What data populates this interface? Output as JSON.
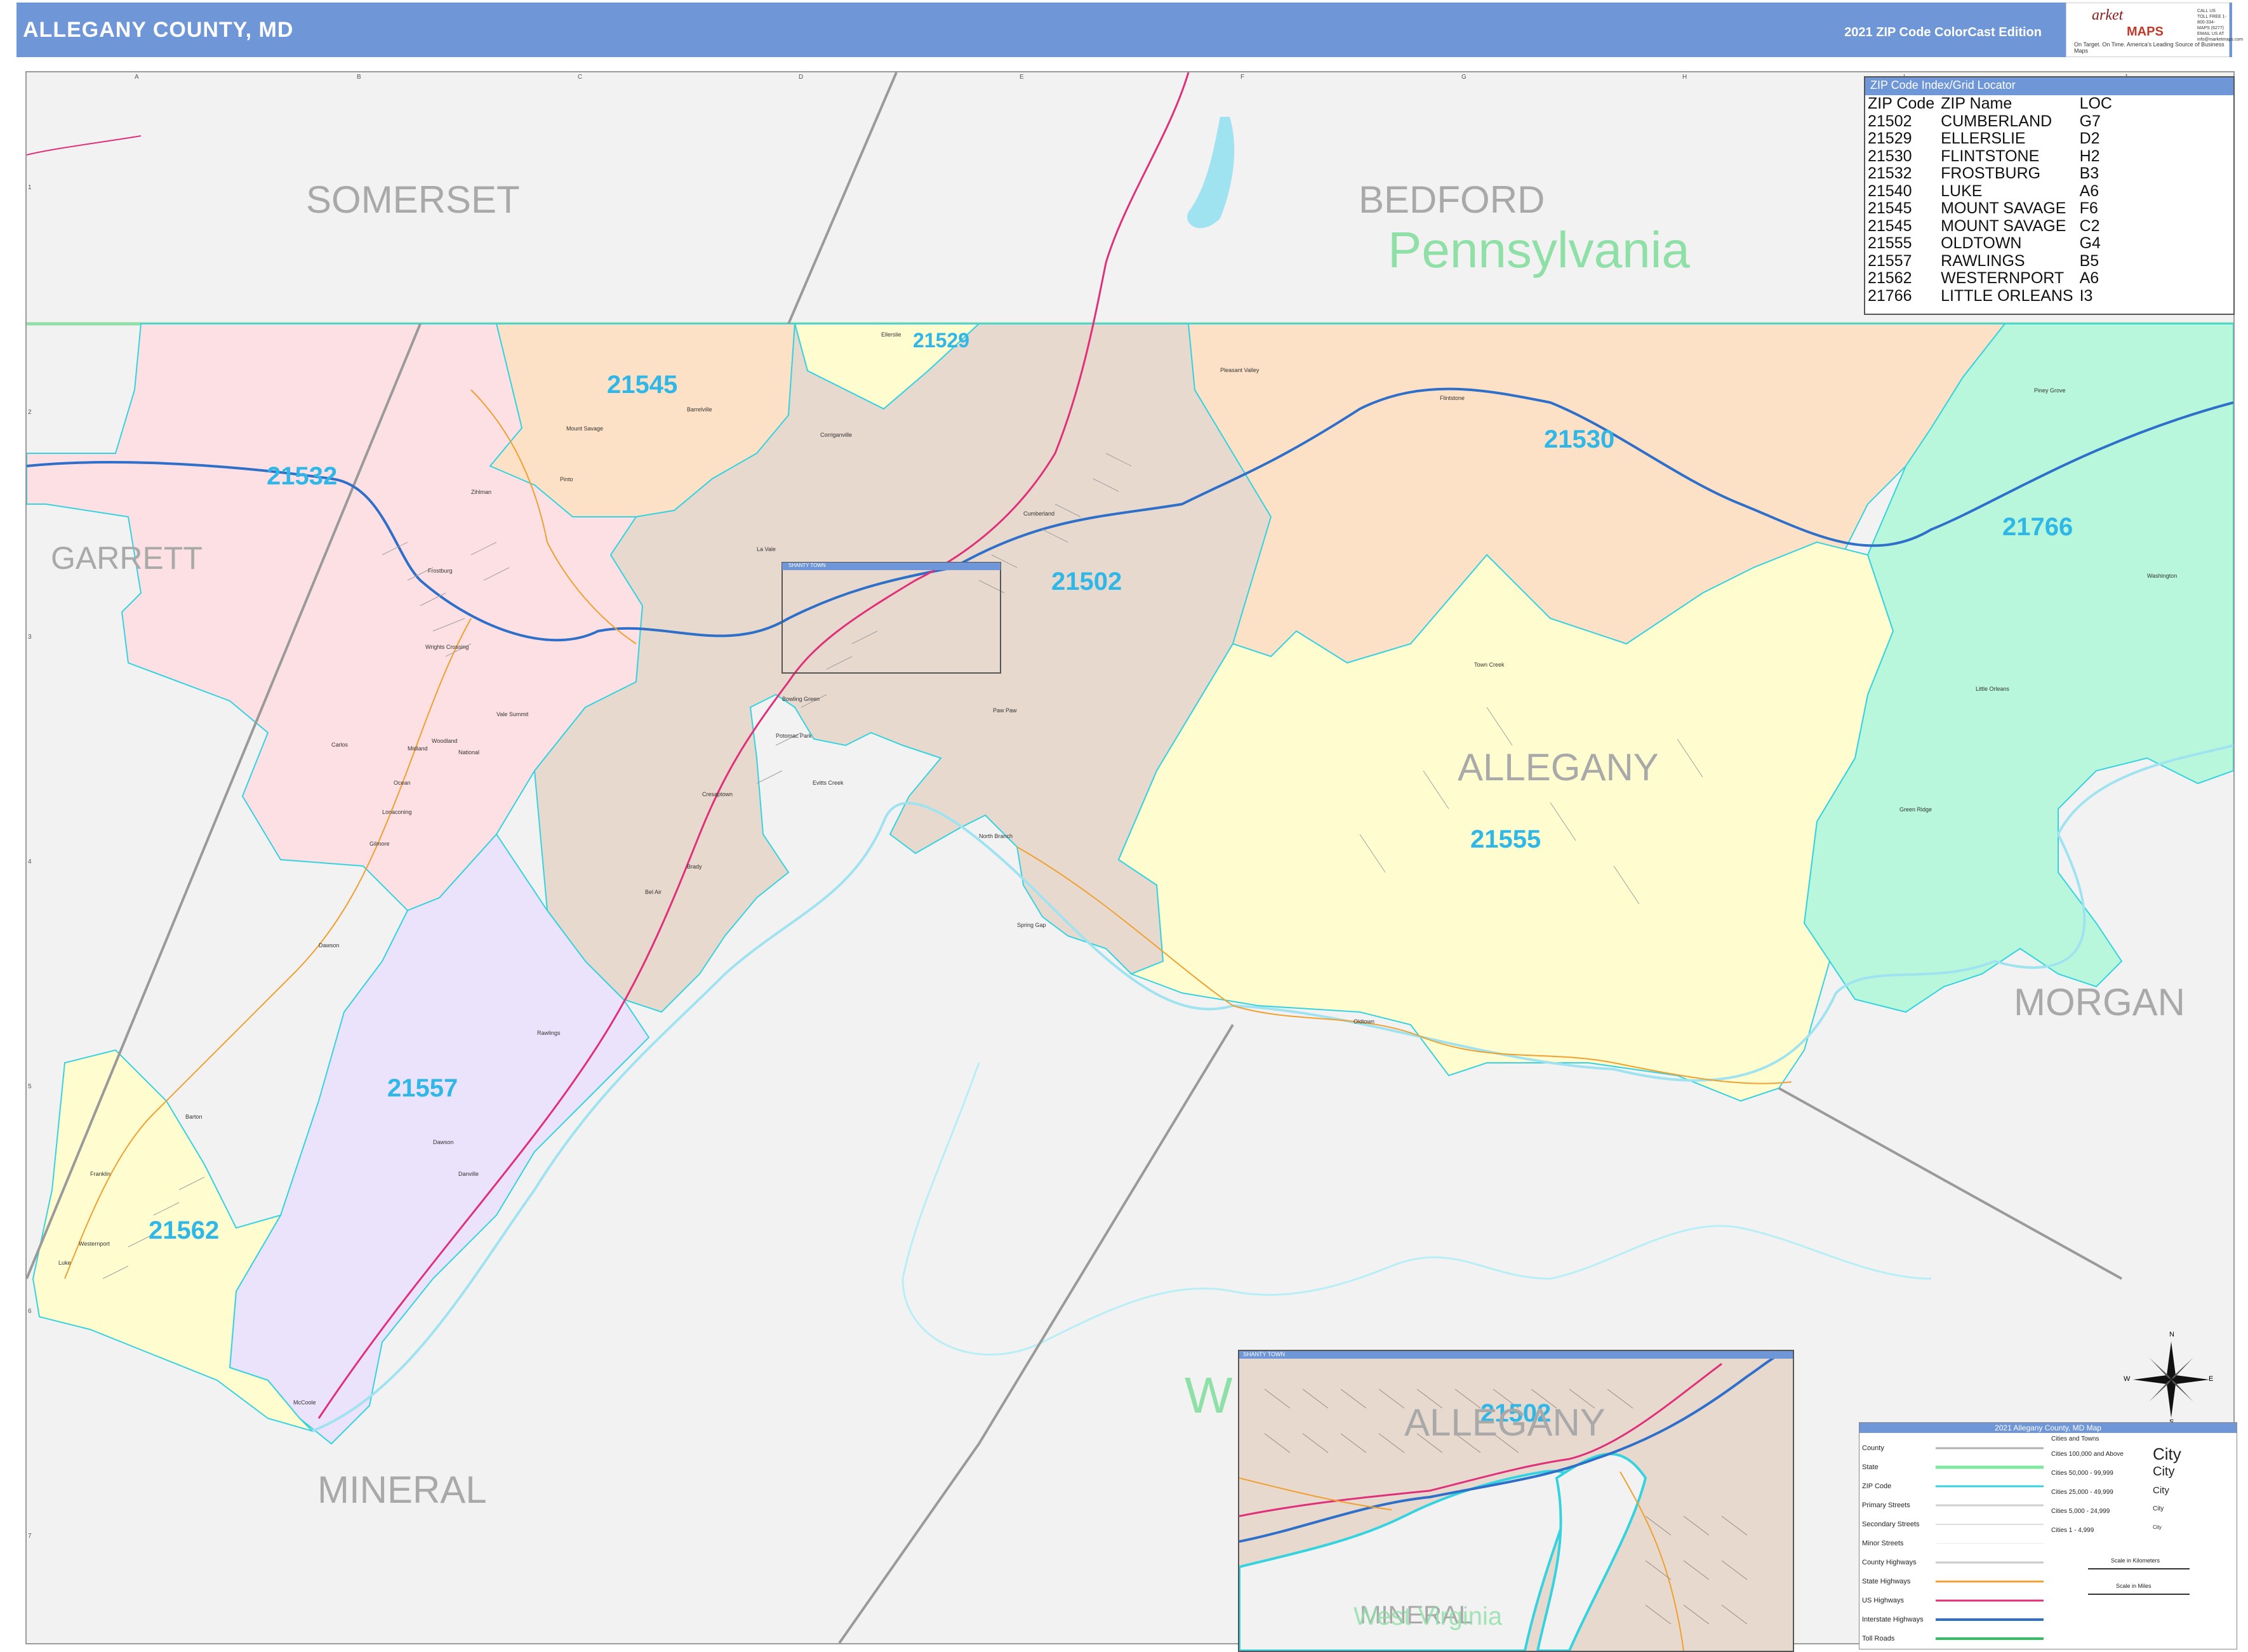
{
  "header": {
    "title": "ALLEGANY COUNTY, MD",
    "edition": "2021 ZIP Code ColorCast Edition"
  },
  "logo": {
    "name_top": "arket",
    "name_bottom": "MAPS",
    "tagline": "On Target. On Time. America's Leading Source of Business Maps",
    "contact": "CALL US TOLL FREE 1-800-334-MAPS (6277) EMAIL US AT info@marketmaps.com"
  },
  "grid": {
    "letters": [
      "A",
      "B",
      "C",
      "D",
      "E",
      "F",
      "G",
      "H",
      "I",
      "J"
    ],
    "numbers": [
      "1",
      "2",
      "3",
      "4",
      "5",
      "6",
      "7"
    ]
  },
  "counties": [
    "SOMERSET",
    "BEDFORD",
    "GARRETT",
    "ALLEGANY",
    "MORGAN",
    "MINERAL"
  ],
  "states": [
    "Pennsylvania",
    "W"
  ],
  "zip_labels": [
    "21545",
    "21529",
    "21532",
    "21502",
    "21530",
    "21766",
    "21555",
    "21557",
    "21562"
  ],
  "places": [
    "Frostburg",
    "Cumberland",
    "Mount Savage",
    "Barrelville",
    "Lonaconing",
    "Midland",
    "Westernport",
    "Luke",
    "Rawlings",
    "McCoole",
    "Flintstone",
    "Oldtown",
    "Little Orleans",
    "Ellerslie",
    "Corriganville",
    "La Vale",
    "Eckhart Mines",
    "Bowling Green",
    "Cresaptown",
    "Bel Air",
    "Potomac Park",
    "Town Creek",
    "Green Ridge",
    "Piney Grove",
    "Pleasant Valley",
    "North Branch",
    "Spring Gap",
    "Barton",
    "Franklin",
    "Klondike",
    "Grahamtown",
    "Vale Summit",
    "Ocean",
    "Gilmore",
    "Carlos",
    "Wrights Crossing",
    "Zihlman",
    "Shaft",
    "Borden Shaft",
    "Woodland",
    "National",
    "Dawson",
    "Keyser",
    "Morantown",
    "Allegany",
    "Pinto",
    "Amcelle",
    "Dickens",
    "Charlestown",
    "Pekin",
    "Mt Pleasant",
    "Reynolds",
    "Dawes",
    "Garrison",
    "Loarville",
    "Klein Summit",
    "Ellerslie Jct",
    "Mount Savage Junction",
    "Hazelwood",
    "Locust Grove",
    "La Vale Lucas Heights",
    "Amcelle Acres",
    "Brady",
    "Evitts Creek",
    "Paw Paw",
    "Moscow",
    "Midlothian",
    "Nikep",
    "Wellersburg",
    "Woodland Park",
    "Oakhill",
    "Wills Creek",
    "Clarysville",
    "Eckhart",
    "Hoffman",
    "Ravenwood",
    "Pattee",
    "Black Oak",
    "Danville",
    "Dawson",
    "Shanty Town",
    "Washington"
  ],
  "zip_index": {
    "title": "ZIP Code Index/Grid Locator",
    "headers": [
      "ZIP Code",
      "ZIP Name",
      "LOC"
    ],
    "rows": [
      [
        "21502",
        "CUMBERLAND",
        "G7"
      ],
      [
        "21529",
        "ELLERSLIE",
        "D2"
      ],
      [
        "21530",
        "FLINTSTONE",
        "H2"
      ],
      [
        "21532",
        "FROSTBURG",
        "B3"
      ],
      [
        "21540",
        "LUKE",
        "A6"
      ],
      [
        "21545",
        "MOUNT SAVAGE",
        "F6"
      ],
      [
        "21545",
        "MOUNT SAVAGE",
        "C2"
      ],
      [
        "21555",
        "OLDTOWN",
        "G4"
      ],
      [
        "21557",
        "RAWLINGS",
        "B5"
      ],
      [
        "21562",
        "WESTERNPORT",
        "A6"
      ],
      [
        "21766",
        "LITTLE ORLEANS",
        "I3"
      ]
    ]
  },
  "inset": {
    "title": "SHANTY TOWN",
    "zip": "21502",
    "county": "ALLEGANY",
    "county2": "MINERAL",
    "state": "West Virginia"
  },
  "small_inset_title": "SHANTY TOWN",
  "legend": {
    "title": "2021 Allegany County, MD Map",
    "rows": [
      "County",
      "State",
      "ZIP Code",
      "Primary Streets",
      "Secondary Streets",
      "Minor Streets",
      "County Highways",
      "State Highways",
      "US Highways",
      "Interstate Highways",
      "Toll Roads"
    ],
    "cities_header": "Cities and Towns",
    "cities": [
      {
        "label": "Cities 100,000 and Above",
        "sample": "City"
      },
      {
        "label": "Cities 50,000 - 99,999",
        "sample": "City"
      },
      {
        "label": "Cities 25,000 - 49,999",
        "sample": "City"
      },
      {
        "label": "Cities 5,000 - 24,999",
        "sample": "City"
      },
      {
        "label": "Cities 1 - 4,999",
        "sample": "City"
      }
    ],
    "scale_km": "Scale in Kilometers",
    "scale_mi": "Scale in Miles",
    "colors": {
      "county": "#b0b0b0",
      "state": "#7de8a0",
      "zip": "#35d3e0",
      "primary": "#cfcfcf",
      "county_hwy": "#c9c9c9",
      "state_hwy": "#f0a030",
      "us_hwy": "#e0307a",
      "interstate": "#2e6fc9",
      "toll": "#30c060"
    }
  },
  "compass": {
    "n": "N",
    "s": "S",
    "e": "E",
    "w": "W"
  },
  "zip_colors": {
    "21545": "#fde1c6",
    "21529": "#fffdd0",
    "21532": "#fde0e4",
    "21502": "#e8d9cf",
    "21530": "#fde1c6",
    "21766": "#b8f7dc",
    "21555": "#fffdd0",
    "21557": "#ebe2fb",
    "21562": "#fffdd0"
  }
}
